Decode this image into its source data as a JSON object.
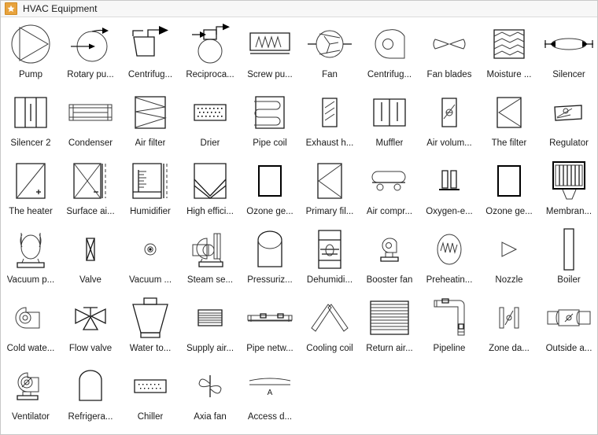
{
  "window": {
    "title": "HVAC Equipment",
    "icon": "star-icon",
    "accent_color": "#e8a33d",
    "titlebar_bg": "#f7f7f7",
    "border_color": "#c8c8c8",
    "stroke_color": "#1a1a1a",
    "background": "#ffffff"
  },
  "stencil": {
    "columns": 10,
    "rows": 6,
    "item_count": 55,
    "items": [
      {
        "label": "Pump",
        "icon": "pump-icon"
      },
      {
        "label": "Rotary pu...",
        "icon": "rotary-pump-icon"
      },
      {
        "label": "Centrifug...",
        "icon": "centrifugal-pump-icon"
      },
      {
        "label": "Reciproca...",
        "icon": "reciprocating-pump-icon"
      },
      {
        "label": "Screw pu...",
        "icon": "screw-pump-icon"
      },
      {
        "label": "Fan",
        "icon": "fan-icon"
      },
      {
        "label": "Centrifug...",
        "icon": "centrifugal-fan-icon"
      },
      {
        "label": "Fan blades",
        "icon": "fan-blades-icon"
      },
      {
        "label": "Moisture ...",
        "icon": "moisture-separator-icon"
      },
      {
        "label": "Silencer",
        "icon": "silencer-icon"
      },
      {
        "label": "Silencer 2",
        "icon": "silencer-2-icon"
      },
      {
        "label": "Condenser",
        "icon": "condenser-icon"
      },
      {
        "label": "Air filter",
        "icon": "air-filter-icon"
      },
      {
        "label": "Drier",
        "icon": "drier-icon"
      },
      {
        "label": "Pipe coil",
        "icon": "pipe-coil-icon"
      },
      {
        "label": "Exhaust h...",
        "icon": "exhaust-hood-icon"
      },
      {
        "label": "Muffler",
        "icon": "muffler-icon"
      },
      {
        "label": "Air volum...",
        "icon": "air-volume-regulator-icon"
      },
      {
        "label": "The filter",
        "icon": "the-filter-icon"
      },
      {
        "label": "Regulator",
        "icon": "regulator-icon"
      },
      {
        "label": "The heater",
        "icon": "heater-icon"
      },
      {
        "label": "Surface ai...",
        "icon": "surface-air-cooler-icon"
      },
      {
        "label": "Humidifier",
        "icon": "humidifier-icon"
      },
      {
        "label": "High effici...",
        "icon": "high-efficiency-filter-icon"
      },
      {
        "label": "Ozone ge...",
        "icon": "ozone-generator-icon"
      },
      {
        "label": "Primary fil...",
        "icon": "primary-filter-icon"
      },
      {
        "label": "Air compr...",
        "icon": "air-compressor-icon"
      },
      {
        "label": "Oxygen-e...",
        "icon": "oxygen-equipment-icon"
      },
      {
        "label": "Ozone ge...",
        "icon": "ozone-generator-2-icon"
      },
      {
        "label": "Membran...",
        "icon": "membrane-filter-icon"
      },
      {
        "label": "Vacuum p...",
        "icon": "vacuum-pump-icon"
      },
      {
        "label": "Valve",
        "icon": "valve-icon"
      },
      {
        "label": "Vacuum ...",
        "icon": "vacuum-gauge-icon"
      },
      {
        "label": "Steam se...",
        "icon": "steam-separator-icon"
      },
      {
        "label": "Pressuriz...",
        "icon": "pressurized-tank-icon"
      },
      {
        "label": "Dehumidi...",
        "icon": "dehumidifier-icon"
      },
      {
        "label": "Booster fan",
        "icon": "booster-fan-icon"
      },
      {
        "label": "Preheatin...",
        "icon": "preheating-coil-icon"
      },
      {
        "label": "Nozzle",
        "icon": "nozzle-icon"
      },
      {
        "label": "Boiler",
        "icon": "boiler-icon"
      },
      {
        "label": "Cold wate...",
        "icon": "cold-water-pump-icon"
      },
      {
        "label": "Flow valve",
        "icon": "flow-valve-icon"
      },
      {
        "label": "Water to...",
        "icon": "water-tower-icon"
      },
      {
        "label": "Supply air...",
        "icon": "supply-air-grille-icon"
      },
      {
        "label": "Pipe netw...",
        "icon": "pipe-network-icon"
      },
      {
        "label": "Cooling coil",
        "icon": "cooling-coil-icon"
      },
      {
        "label": "Return air...",
        "icon": "return-air-grille-icon"
      },
      {
        "label": "Pipeline",
        "icon": "pipeline-icon"
      },
      {
        "label": "Zone da...",
        "icon": "zone-damper-icon"
      },
      {
        "label": "Outside a...",
        "icon": "outside-air-duct-icon"
      },
      {
        "label": "Ventilator",
        "icon": "ventilator-icon"
      },
      {
        "label": "Refrigera...",
        "icon": "refrigerator-icon"
      },
      {
        "label": "Chiller",
        "icon": "chiller-icon"
      },
      {
        "label": "Axia fan",
        "icon": "axial-fan-icon"
      },
      {
        "label": "Access d...",
        "icon": "access-door-icon",
        "annotation": "A"
      }
    ]
  }
}
